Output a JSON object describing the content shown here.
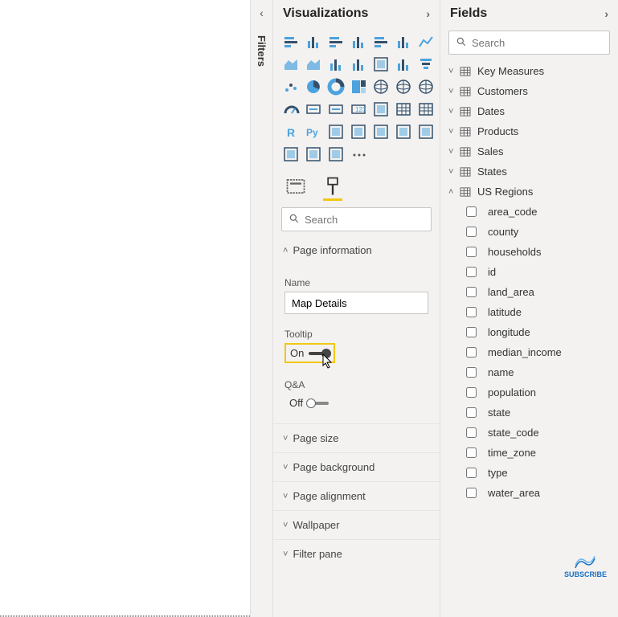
{
  "panes": {
    "filters": {
      "label": "Filters"
    },
    "visualizations": {
      "title": "Visualizations",
      "search_placeholder": "Search",
      "tabs": {
        "fields": "fields-well",
        "format": "format"
      },
      "sections": {
        "page_information": {
          "label": "Page information",
          "name_label": "Name",
          "name_value": "Map Details",
          "tooltip_label": "Tooltip",
          "tooltip_state": "On",
          "qa_label": "Q&A",
          "qa_state": "Off"
        },
        "page_size": {
          "label": "Page size"
        },
        "page_background": {
          "label": "Page background"
        },
        "page_alignment": {
          "label": "Page alignment"
        },
        "wallpaper": {
          "label": "Wallpaper"
        },
        "filter_pane": {
          "label": "Filter pane"
        }
      },
      "viz_names": [
        "stacked-bar-chart",
        "stacked-column-chart",
        "clustered-bar-chart",
        "clustered-column-chart",
        "stacked-bar-100",
        "stacked-column-100",
        "line-chart",
        "area-chart",
        "stacked-area-chart",
        "line-clustered-column",
        "line-stacked-column",
        "ribbon-chart",
        "waterfall-chart",
        "funnel-chart",
        "scatter-chart",
        "pie-chart",
        "donut-chart",
        "treemap",
        "map",
        "filled-map",
        "azure-map",
        "gauge",
        "card",
        "multi-row-card",
        "kpi",
        "slicer",
        "table",
        "matrix",
        "r-script-visual",
        "python-visual",
        "key-influencers",
        "decomposition-tree",
        "qa-visual",
        "smart-narrative",
        "paginated-report",
        "arcgis",
        "powerapps",
        "powerautomate",
        "more-visuals"
      ]
    },
    "fields": {
      "title": "Fields",
      "search_placeholder": "Search",
      "tables": [
        {
          "name": "Key Measures",
          "expanded": false
        },
        {
          "name": "Customers",
          "expanded": false
        },
        {
          "name": "Dates",
          "expanded": false
        },
        {
          "name": "Products",
          "expanded": false
        },
        {
          "name": "Sales",
          "expanded": false
        },
        {
          "name": "States",
          "expanded": false
        },
        {
          "name": "US Regions",
          "expanded": true,
          "fields": [
            "area_code",
            "county",
            "households",
            "id",
            "land_area",
            "latitude",
            "longitude",
            "median_income",
            "name",
            "population",
            "state",
            "state_code",
            "time_zone",
            "type",
            "water_area"
          ]
        }
      ]
    }
  },
  "watermark": "SUBSCRIBE"
}
